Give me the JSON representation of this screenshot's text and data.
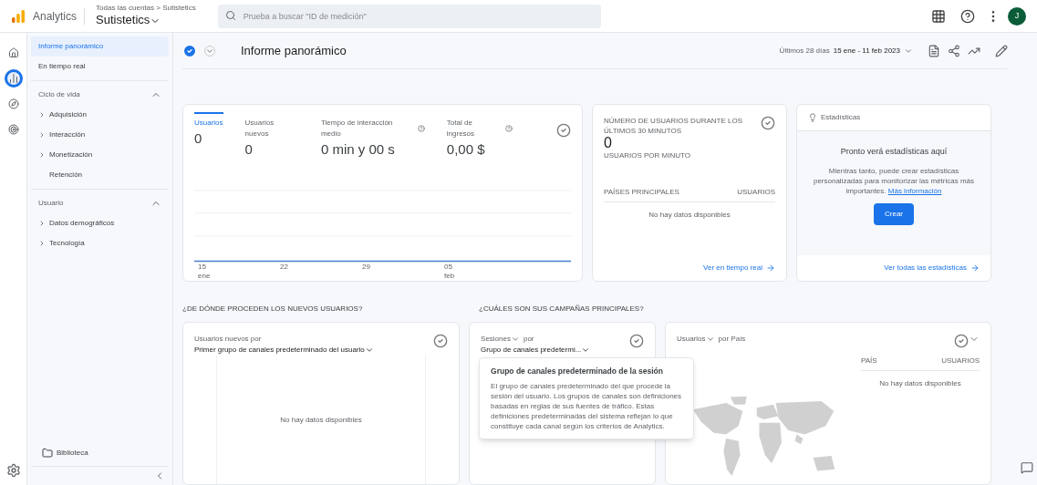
{
  "topbar": {
    "product": "Analytics",
    "breadcrumb": "Todas las cuentas > Sutistetics",
    "property": "Sutistetics",
    "search": {
      "placeholder": "Prueba a buscar \"ID de medición\""
    },
    "avatar": "J"
  },
  "rail": [
    {
      "kind": "home",
      "selected": false
    },
    {
      "kind": "reports",
      "selected": true
    },
    {
      "kind": "explore",
      "selected": false
    },
    {
      "kind": "ads",
      "selected": false
    }
  ],
  "nav": {
    "items": [
      {
        "label": "Informe panorámico",
        "selected": true
      },
      {
        "label": "En tiempo real",
        "selected": false
      }
    ],
    "sections": [
      {
        "label": "Ciclo de vida",
        "expanded": true,
        "children": [
          {
            "label": "Adquisición",
            "expanded": false
          },
          {
            "label": "Interacción",
            "expanded": false
          },
          {
            "label": "Monetización",
            "expanded": false
          },
          {
            "label": "Retención"
          }
        ]
      },
      {
        "label": "Usuario",
        "expanded": true,
        "children": [
          {
            "label": "Datos demográficos",
            "expanded": false
          },
          {
            "label": "Tecnología",
            "expanded": false
          }
        ]
      }
    ],
    "library": "Biblioteca"
  },
  "header": {
    "title": "Informe panorámico",
    "date_label": "Últimos 28 días",
    "date_range": "15 ene - 11 feb 2023"
  },
  "metrics": [
    {
      "label": "Usuarios",
      "value": "0",
      "selected": true,
      "info": false
    },
    {
      "label": "Usuarios nuevos",
      "value": "0",
      "selected": false,
      "info": false
    },
    {
      "label": "Tiempo de interacción medio",
      "value": "0 min y 00 s",
      "selected": false,
      "info": true
    },
    {
      "label": "Total de ingresos",
      "value": "0,00 $",
      "selected": false,
      "info": true
    }
  ],
  "chart_ticks": [
    {
      "day": "15",
      "month": "ene"
    },
    {
      "day": "22"
    },
    {
      "day": "29"
    },
    {
      "day": "05",
      "month": "feb"
    }
  ],
  "realtime": {
    "title": "NÚMERO DE USUARIOS DURANTE LOS ÚLTIMOS 30 MINUTOS",
    "value": "0",
    "sub": "USUARIOS POR MINUTO",
    "col1": "PAÍSES PRINCIPALES",
    "col2": "USUARIOS",
    "empty": "No hay datos disponibles",
    "link": "Ver en tiempo real"
  },
  "insights": {
    "title": "Estadísticas",
    "heading": "Pronto verá estadísticas aquí",
    "body": "Mientras tanto, puede crear estadísticas personalizadas para monitorizar las métricas más importantes.",
    "link": "Más información",
    "button": "Crear",
    "footer": "Ver todas las estadísticas"
  },
  "sections": [
    "¿DE DÓNDE PROCEDEN LOS NUEVOS USUARIOS?",
    "¿CUÁLES SON SUS CAMPAÑAS PRINCIPALES?"
  ],
  "new_users": {
    "metric": "Usuarios nuevos por",
    "dimension": "Primer grupo de canales predeterminado del usuario",
    "empty": "No hay datos disponibles"
  },
  "campaigns": {
    "metric": "Sesiones",
    "by": "por",
    "dimension": "Grupo de canales predetermi...",
    "tooltip_title": "Grupo de canales predeterminado de la sesión",
    "tooltip_body": "El grupo de canales predeterminado del que procede la sesión del usuario. Los grupos de canales son definiciones basadas en reglas de sus fuentes de tráfico. Estas definiciones predeterminadas del sistema reflejan lo que constituye cada canal según los criterios de Analytics."
  },
  "countries": {
    "metric": "Usuarios",
    "by": "por País",
    "col1": "PAÍS",
    "col2": "USUARIOS",
    "empty": "No hay datos disponibles"
  }
}
